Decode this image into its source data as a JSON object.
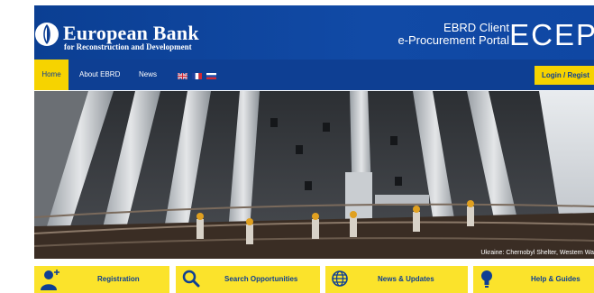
{
  "header": {
    "brand_title": "European Bank",
    "brand_subtitle": "for Reconstruction and Development",
    "portal_line1": "EBRD Client",
    "portal_line2": "e-Procurement Portal",
    "portal_acronym": "ECEP"
  },
  "nav": {
    "items": [
      {
        "label": "Home",
        "active": true
      },
      {
        "label": "About EBRD"
      },
      {
        "label": "News"
      }
    ],
    "flags": [
      "uk-flag-icon",
      "france-flag-icon",
      "russia-flag-icon"
    ],
    "login_label": "Login / Regist"
  },
  "hero": {
    "caption": "Ukraine: Chernobyl Shelter, Western Wa"
  },
  "tiles": [
    {
      "label": "Registration",
      "icon": "user-add-icon"
    },
    {
      "label": "Search Opportunities",
      "icon": "search-icon"
    },
    {
      "label": "News & Updates",
      "icon": "globe-icon"
    },
    {
      "label": "Help & Guides",
      "icon": "lightbulb-icon"
    }
  ],
  "colors": {
    "brand_blue": "#0e3f93",
    "accent_yellow": "#f6d300",
    "tile_yellow": "#fbe32b"
  }
}
